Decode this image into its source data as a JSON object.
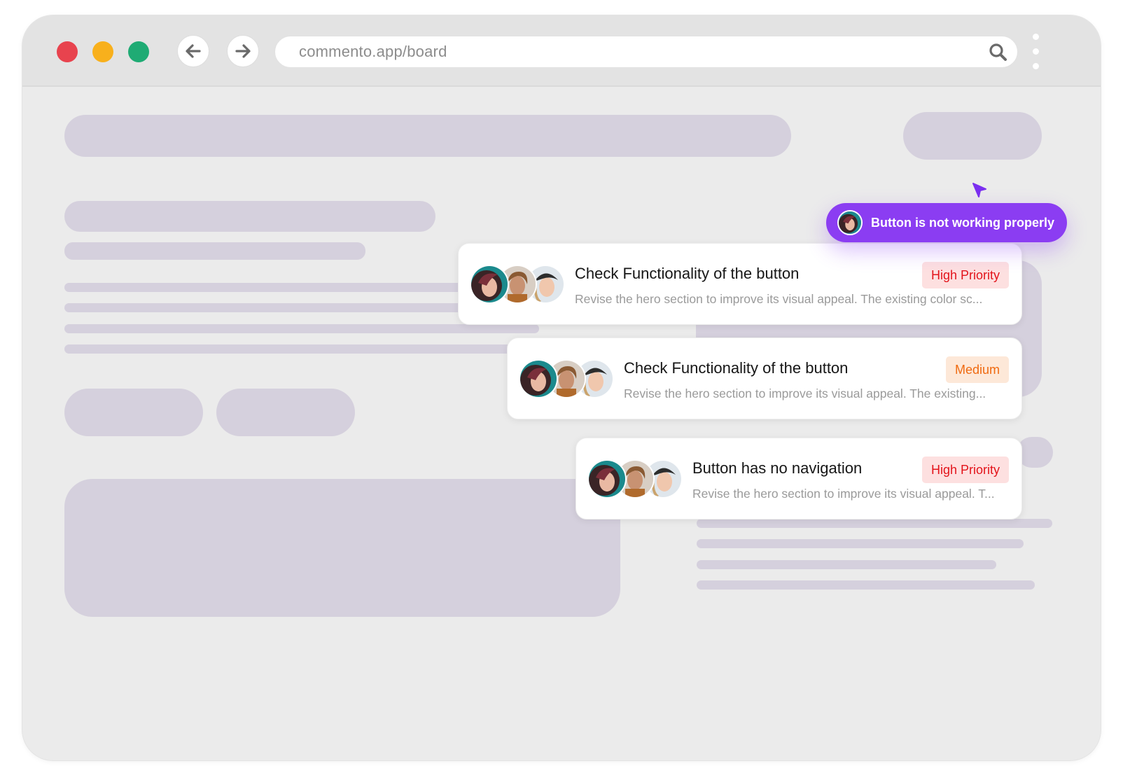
{
  "browser": {
    "url": "commento.app/board",
    "colors": {
      "close": "#e8434e",
      "minimize": "#f8b01c",
      "maximize": "#1fab74"
    }
  },
  "tooltip": {
    "text": "Button is not working properly",
    "color": "#8b3df2"
  },
  "cards": [
    {
      "title": "Check Functionality of the button",
      "description": "Revise the hero section to improve its visual appeal. The existing color sc...",
      "priority": "High Priority"
    },
    {
      "title": "Check Functionality of the button",
      "description": "Revise the hero section to improve its visual appeal. The existing...",
      "priority": "Medium"
    },
    {
      "title": "Button has no navigation",
      "description": "Revise the hero section to improve its visual appeal. T...",
      "priority": "High Priority"
    }
  ]
}
